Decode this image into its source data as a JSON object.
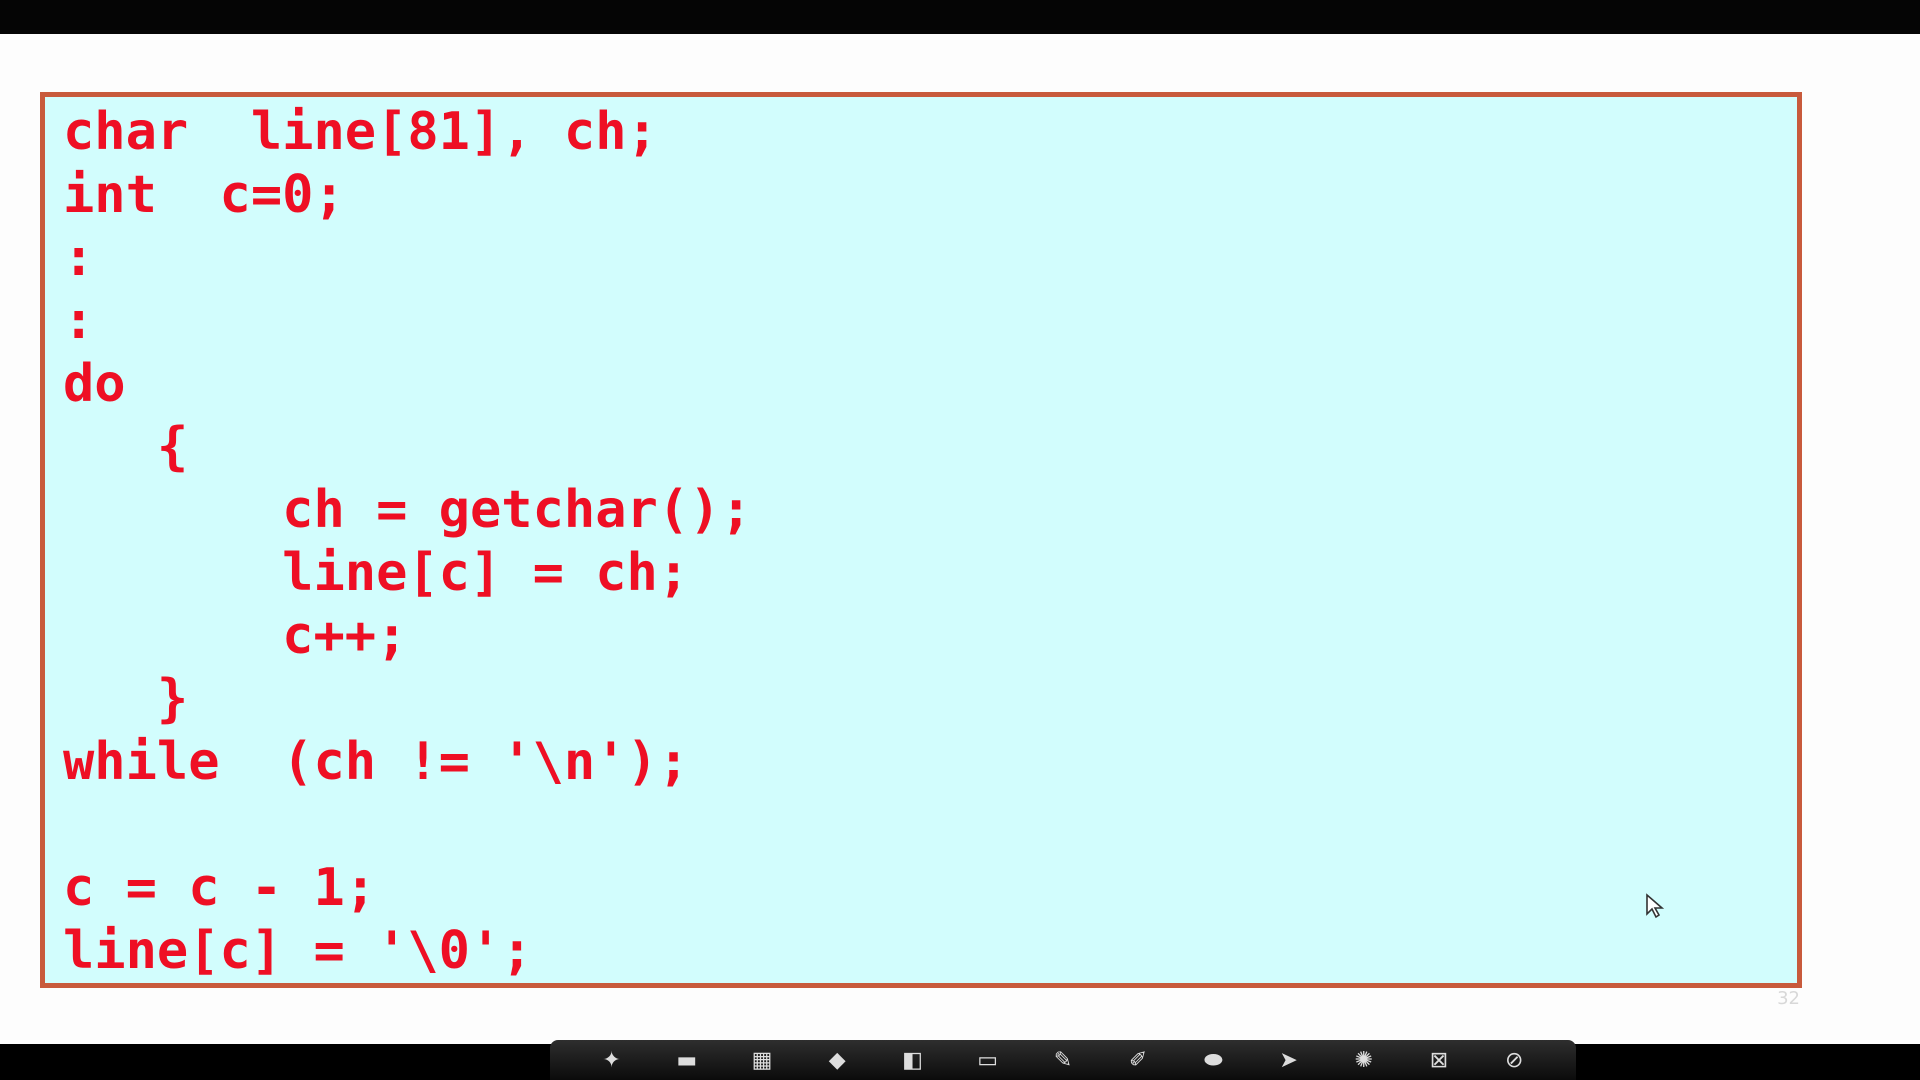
{
  "code_lines": [
    "char  line[81], ch;",
    "int  c=0;",
    ":",
    ":",
    "do",
    "   {",
    "       ch = getchar();",
    "       line[c] = ch;",
    "       c++;",
    "   }",
    "while  (ch != '\\n');",
    "",
    "c = c - 1;",
    "line[c] = '\\0';"
  ],
  "slide_number": "32",
  "colors": {
    "code_text": "#ee0f24",
    "box_background": "#d2fdfd",
    "box_border": "#c85a3c"
  },
  "toolbar": {
    "tools": [
      {
        "name": "pointer-tool",
        "icon": "✦"
      },
      {
        "name": "folder-tool",
        "icon": "▬"
      },
      {
        "name": "capture-tool",
        "icon": "▦"
      },
      {
        "name": "shape-tool",
        "icon": "◆"
      },
      {
        "name": "board-tool",
        "icon": "◧"
      },
      {
        "name": "keyboard-tool",
        "icon": "▭"
      },
      {
        "name": "pen-tool",
        "icon": "✎"
      },
      {
        "name": "highlighter-tool",
        "icon": "✐"
      },
      {
        "name": "eraser-tool",
        "icon": "⬬"
      },
      {
        "name": "select-tool",
        "icon": "➤"
      },
      {
        "name": "spotlight-tool",
        "icon": "✺"
      },
      {
        "name": "screen-tool",
        "icon": "⊠"
      },
      {
        "name": "clear-tool",
        "icon": "⊘"
      }
    ]
  }
}
